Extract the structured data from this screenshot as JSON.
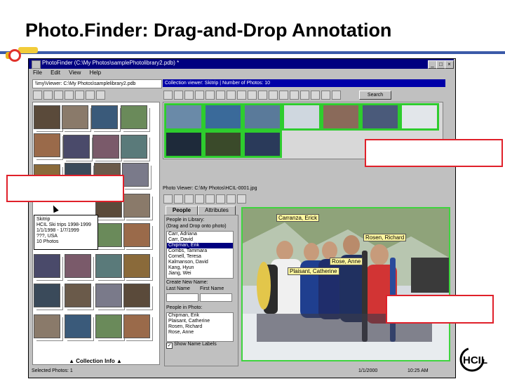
{
  "slide_title": "Photo.Finder: Drag-and-Drop Annotation",
  "window": {
    "title": "PhotoFinder (C:\\My Photos\\samplePhotolibrary2.pdb) *",
    "menu": [
      "File",
      "Edit",
      "View",
      "Help"
    ],
    "left_path": "\\\\my\\Viewer: C:\\My Photos\\samplelibrary2.pdb",
    "collection_viewer_header": "Collection viewer: Skitrip | Number of Photos: 10",
    "search_button": "Search",
    "photo_viewer_header": "Photo Viewer: C:\\My Photos\\HCIL-0001.jpg",
    "side_search_label": "Search",
    "collection_info_label": "Collection Info",
    "popup_lines": [
      "Skitrip",
      "HCIL Ski trips 1998-1999",
      "1/1/1998 - 1/7/1999",
      "???, USA",
      "10 Photos"
    ],
    "tabs": [
      "People",
      "Attributes"
    ],
    "people_in_library_label": "People in Library:",
    "drag_hint": "(Drag and Drop onto photo)",
    "library_people": [
      "Carr, Adriana",
      "Carr, David",
      "Chipman, Erik",
      "Combs, Tammara",
      "Cornell, Teresa",
      "Kalmanson, David",
      "Kang, Hyun",
      "Jiang, Wei"
    ],
    "selected_person_index": 2,
    "create_new_name_label": "Create New Name:",
    "last_name_label": "Last Name",
    "first_name_label": "First Name",
    "people_in_photo_label": "People in Photo:",
    "photo_people": [
      "Chipman, Erik",
      "Plaisant, Catherine",
      "Rosen, Richard",
      "Rose, Anne"
    ],
    "show_name_labels": "Show Name Labels",
    "status_left": "Selected Photos: 1",
    "status_date": "1/1/2000",
    "status_time": "10:25 AM"
  },
  "name_tags": [
    {
      "label": "Carranza, Erick"
    },
    {
      "label": "Rosen, Richard"
    },
    {
      "label": "Rose, Anne"
    },
    {
      "label": "Plaisant, Catherine"
    }
  ],
  "logo_text": "HCIL",
  "colors": {
    "titlebar": "#000080",
    "selection_outline": "#2ecc2e",
    "annotation_box": "#e0202a",
    "name_tag": "#fff8a0"
  }
}
